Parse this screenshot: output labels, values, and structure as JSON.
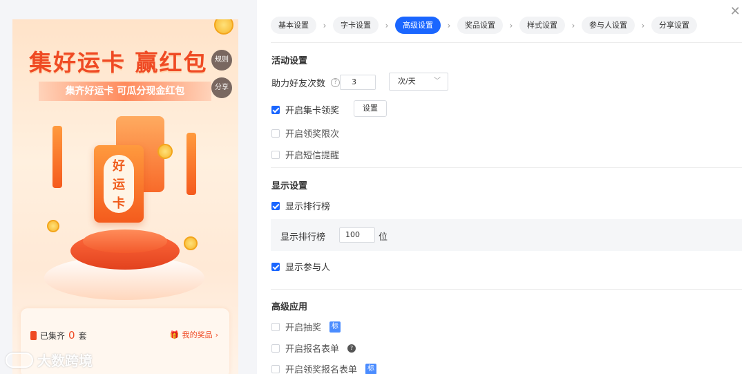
{
  "preview": {
    "title": "集好运卡 赢红包",
    "subtitle": "集齐好运卡 可瓜分现金红包",
    "rules_button": "规则",
    "share_button": "分享",
    "card_text": "好运卡",
    "card_chars": [
      "好",
      "运",
      "卡"
    ],
    "collected_prefix": "已集齐",
    "collected_count": "0",
    "collected_suffix": "套",
    "my_prize": "我的奖品",
    "watermark": "大数跨境"
  },
  "steps": [
    {
      "label": "基本设置",
      "active": false
    },
    {
      "label": "字卡设置",
      "active": false
    },
    {
      "label": "高级设置",
      "active": true
    },
    {
      "label": "奖品设置",
      "active": false
    },
    {
      "label": "样式设置",
      "active": false
    },
    {
      "label": "参与人设置",
      "active": false
    },
    {
      "label": "分享设置",
      "active": false
    }
  ],
  "activity": {
    "section_title": "活动设置",
    "help_friends_label": "助力好友次数",
    "help_friends_value": "3",
    "frequency_value": "次/天",
    "enable_collect_prize": {
      "label": "开启集卡领奖",
      "checked": true
    },
    "settings_button": "设置",
    "enable_prize_limit": {
      "label": "开启领奖限次",
      "checked": false
    },
    "enable_sms": {
      "label": "开启短信提醒",
      "checked": false
    }
  },
  "display": {
    "section_title": "显示设置",
    "show_leaderboard": {
      "label": "显示排行榜",
      "checked": true
    },
    "leaderboard_label": "显示排行榜",
    "leaderboard_value": "100",
    "leaderboard_unit": "位",
    "show_participants": {
      "label": "显示参与人",
      "checked": true
    }
  },
  "advanced": {
    "section_title": "高级应用",
    "enable_lottery": {
      "label": "开启抽奖",
      "checked": false,
      "tag": "标"
    },
    "enable_signup_form": {
      "label": "开启报名表单",
      "checked": false
    },
    "enable_prize_signup_form": {
      "label": "开启领奖报名表单",
      "checked": false,
      "tag": "标"
    }
  },
  "colors": {
    "primary": "#1a66ff",
    "accent": "#ef4a24"
  }
}
